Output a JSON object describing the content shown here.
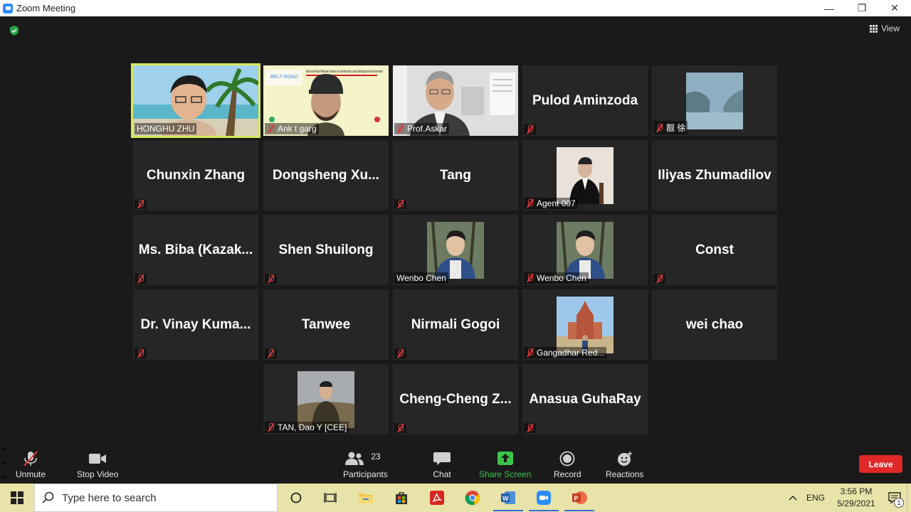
{
  "window": {
    "title": "Zoom Meeting"
  },
  "view_button": {
    "label": "View"
  },
  "participants": [
    {
      "name": "HONGHU ZHU",
      "display": "video",
      "active": true
    },
    {
      "name": "Ank t garg",
      "display": "video"
    },
    {
      "name": "Prof.Askar",
      "display": "video"
    },
    {
      "name": "Pulod Aminzoda",
      "display": "name"
    },
    {
      "name": "靓 徐",
      "display": "photo"
    },
    {
      "name": "Chunxin Zhang",
      "display": "name"
    },
    {
      "name": "Dongsheng  Xu...",
      "display": "name"
    },
    {
      "name": "Tang",
      "display": "name"
    },
    {
      "name": "Agent 007",
      "display": "photo"
    },
    {
      "name": "Iliyas Zhumadilov",
      "display": "name"
    },
    {
      "name": "Ms.  Biba  (Kazak...",
      "display": "name"
    },
    {
      "name": "Shen Shuilong",
      "display": "name"
    },
    {
      "name": "Wenbo Chen",
      "display": "photo"
    },
    {
      "name": "Wenbo Chen",
      "display": "photo"
    },
    {
      "name": "Const",
      "display": "name"
    },
    {
      "name": "Dr.  Vinay  Kuma...",
      "display": "name"
    },
    {
      "name": "Tanwee",
      "display": "name"
    },
    {
      "name": "Nirmali Gogoi",
      "display": "name"
    },
    {
      "name": "Gangadhar Red...",
      "display": "photo"
    },
    {
      "name": "wei chao",
      "display": "name"
    },
    {
      "name": "TAN, Dao Y [CEE]",
      "display": "photo"
    },
    {
      "name": "Cheng-Cheng  Z...",
      "display": "name"
    },
    {
      "name": "Anasua GuhaRay",
      "display": "name"
    }
  ],
  "shared_slide": {
    "title": "Belt and Road Webinar Series on Geotechnics and Underground Environment",
    "logo_text": "BELT ROAD",
    "logo_subtitle": "一带一路"
  },
  "controls": {
    "unmute": "Unmute",
    "stop_video": "Stop Video",
    "participants": "Participants",
    "participants_count": "23",
    "chat": "Chat",
    "share_screen": "Share Screen",
    "record": "Record",
    "reactions": "Reactions",
    "leave": "Leave"
  },
  "taskbar": {
    "search_placeholder": "Type here to search",
    "language": "ENG",
    "time": "3:56 PM",
    "date": "5/29/2021",
    "notification_count": "1"
  },
  "colors": {
    "active_border": "#d8e85a",
    "share_green": "#3cc44a",
    "leave_red": "#e02828"
  }
}
